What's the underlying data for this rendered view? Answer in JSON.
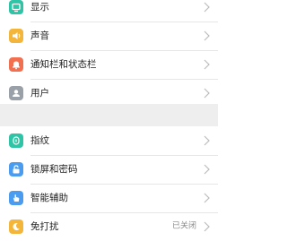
{
  "group1": {
    "items": [
      {
        "label": "显示",
        "icon": "display-icon",
        "color": "#2ec4a6"
      },
      {
        "label": "声音",
        "icon": "speaker-icon",
        "color": "#f4b53b"
      },
      {
        "label": "通知栏和状态栏",
        "icon": "bell-icon",
        "color": "#f2704f"
      },
      {
        "label": "用户",
        "icon": "user-icon",
        "color": "#9aa0a8"
      }
    ]
  },
  "group2": {
    "items": [
      {
        "label": "指纹",
        "icon": "fingerprint-icon",
        "color": "#2ec4a6"
      },
      {
        "label": "锁屏和密码",
        "icon": "lock-icon",
        "color": "#4a9cf0"
      },
      {
        "label": "智能辅助",
        "icon": "hand-icon",
        "color": "#4a9cf0"
      },
      {
        "label": "免打扰",
        "icon": "moon-icon",
        "color": "#f4b53b",
        "value": "已关闭"
      }
    ]
  }
}
